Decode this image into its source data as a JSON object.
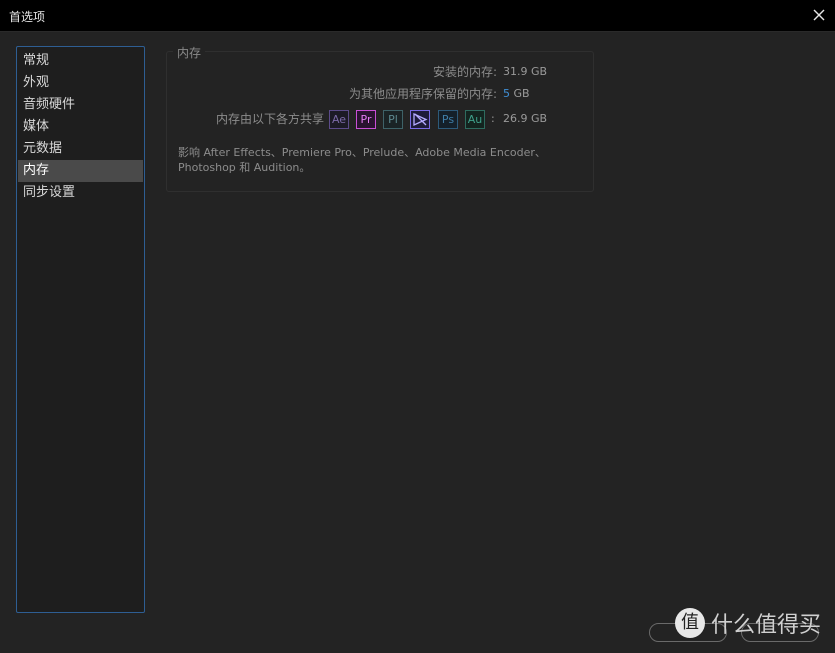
{
  "window": {
    "title": "首选项",
    "close_icon": "close-icon"
  },
  "sidebar": {
    "items": [
      {
        "label": "常规",
        "selected": false
      },
      {
        "label": "外观",
        "selected": false
      },
      {
        "label": "音频硬件",
        "selected": false
      },
      {
        "label": "媒体",
        "selected": false
      },
      {
        "label": "元数据",
        "selected": false
      },
      {
        "label": "内存",
        "selected": true
      },
      {
        "label": "同步设置",
        "selected": false
      }
    ]
  },
  "memory": {
    "group_label": "内存",
    "installed_label": "安装的内存:",
    "installed_value": "31.9 GB",
    "reserved_label": "为其他应用程序保留的内存:",
    "reserved_number": "5",
    "reserved_unit": "GB",
    "shared_label": "内存由以下各方共享",
    "shared_sep": ":",
    "shared_value": "26.9 GB",
    "apps": [
      {
        "name": "Ae",
        "icon": "after-effects-icon",
        "color": "#5c4b8a",
        "text_color": "#7c6aa8",
        "bg": "#1c1a26"
      },
      {
        "name": "Pr",
        "icon": "premiere-icon",
        "color": "#c84fd6",
        "text_color": "#e37cf2",
        "bg": "#2a1330"
      },
      {
        "name": "Pl",
        "icon": "prelude-icon",
        "color": "#3e6268",
        "text_color": "#5e8a90",
        "bg": "#1a2325"
      },
      {
        "name": "",
        "icon": "media-encoder-icon",
        "color": "#7a6be6",
        "text_color": "#b4aaff",
        "bg": "#1d1a3a"
      },
      {
        "name": "Ps",
        "icon": "photoshop-icon",
        "color": "#2d5a7a",
        "text_color": "#3f7ea8",
        "bg": "#14202a"
      },
      {
        "name": "Au",
        "icon": "audition-icon",
        "color": "#2e6b5e",
        "text_color": "#3fa08a",
        "bg": "#13241f"
      }
    ],
    "note_line1": "影响 After Effects、Premiere Pro、Prelude、Adobe Media Encoder、",
    "note_line2": "Photoshop 和 Audition。"
  },
  "watermark": {
    "symbol": "值",
    "text": "什么值得买"
  }
}
